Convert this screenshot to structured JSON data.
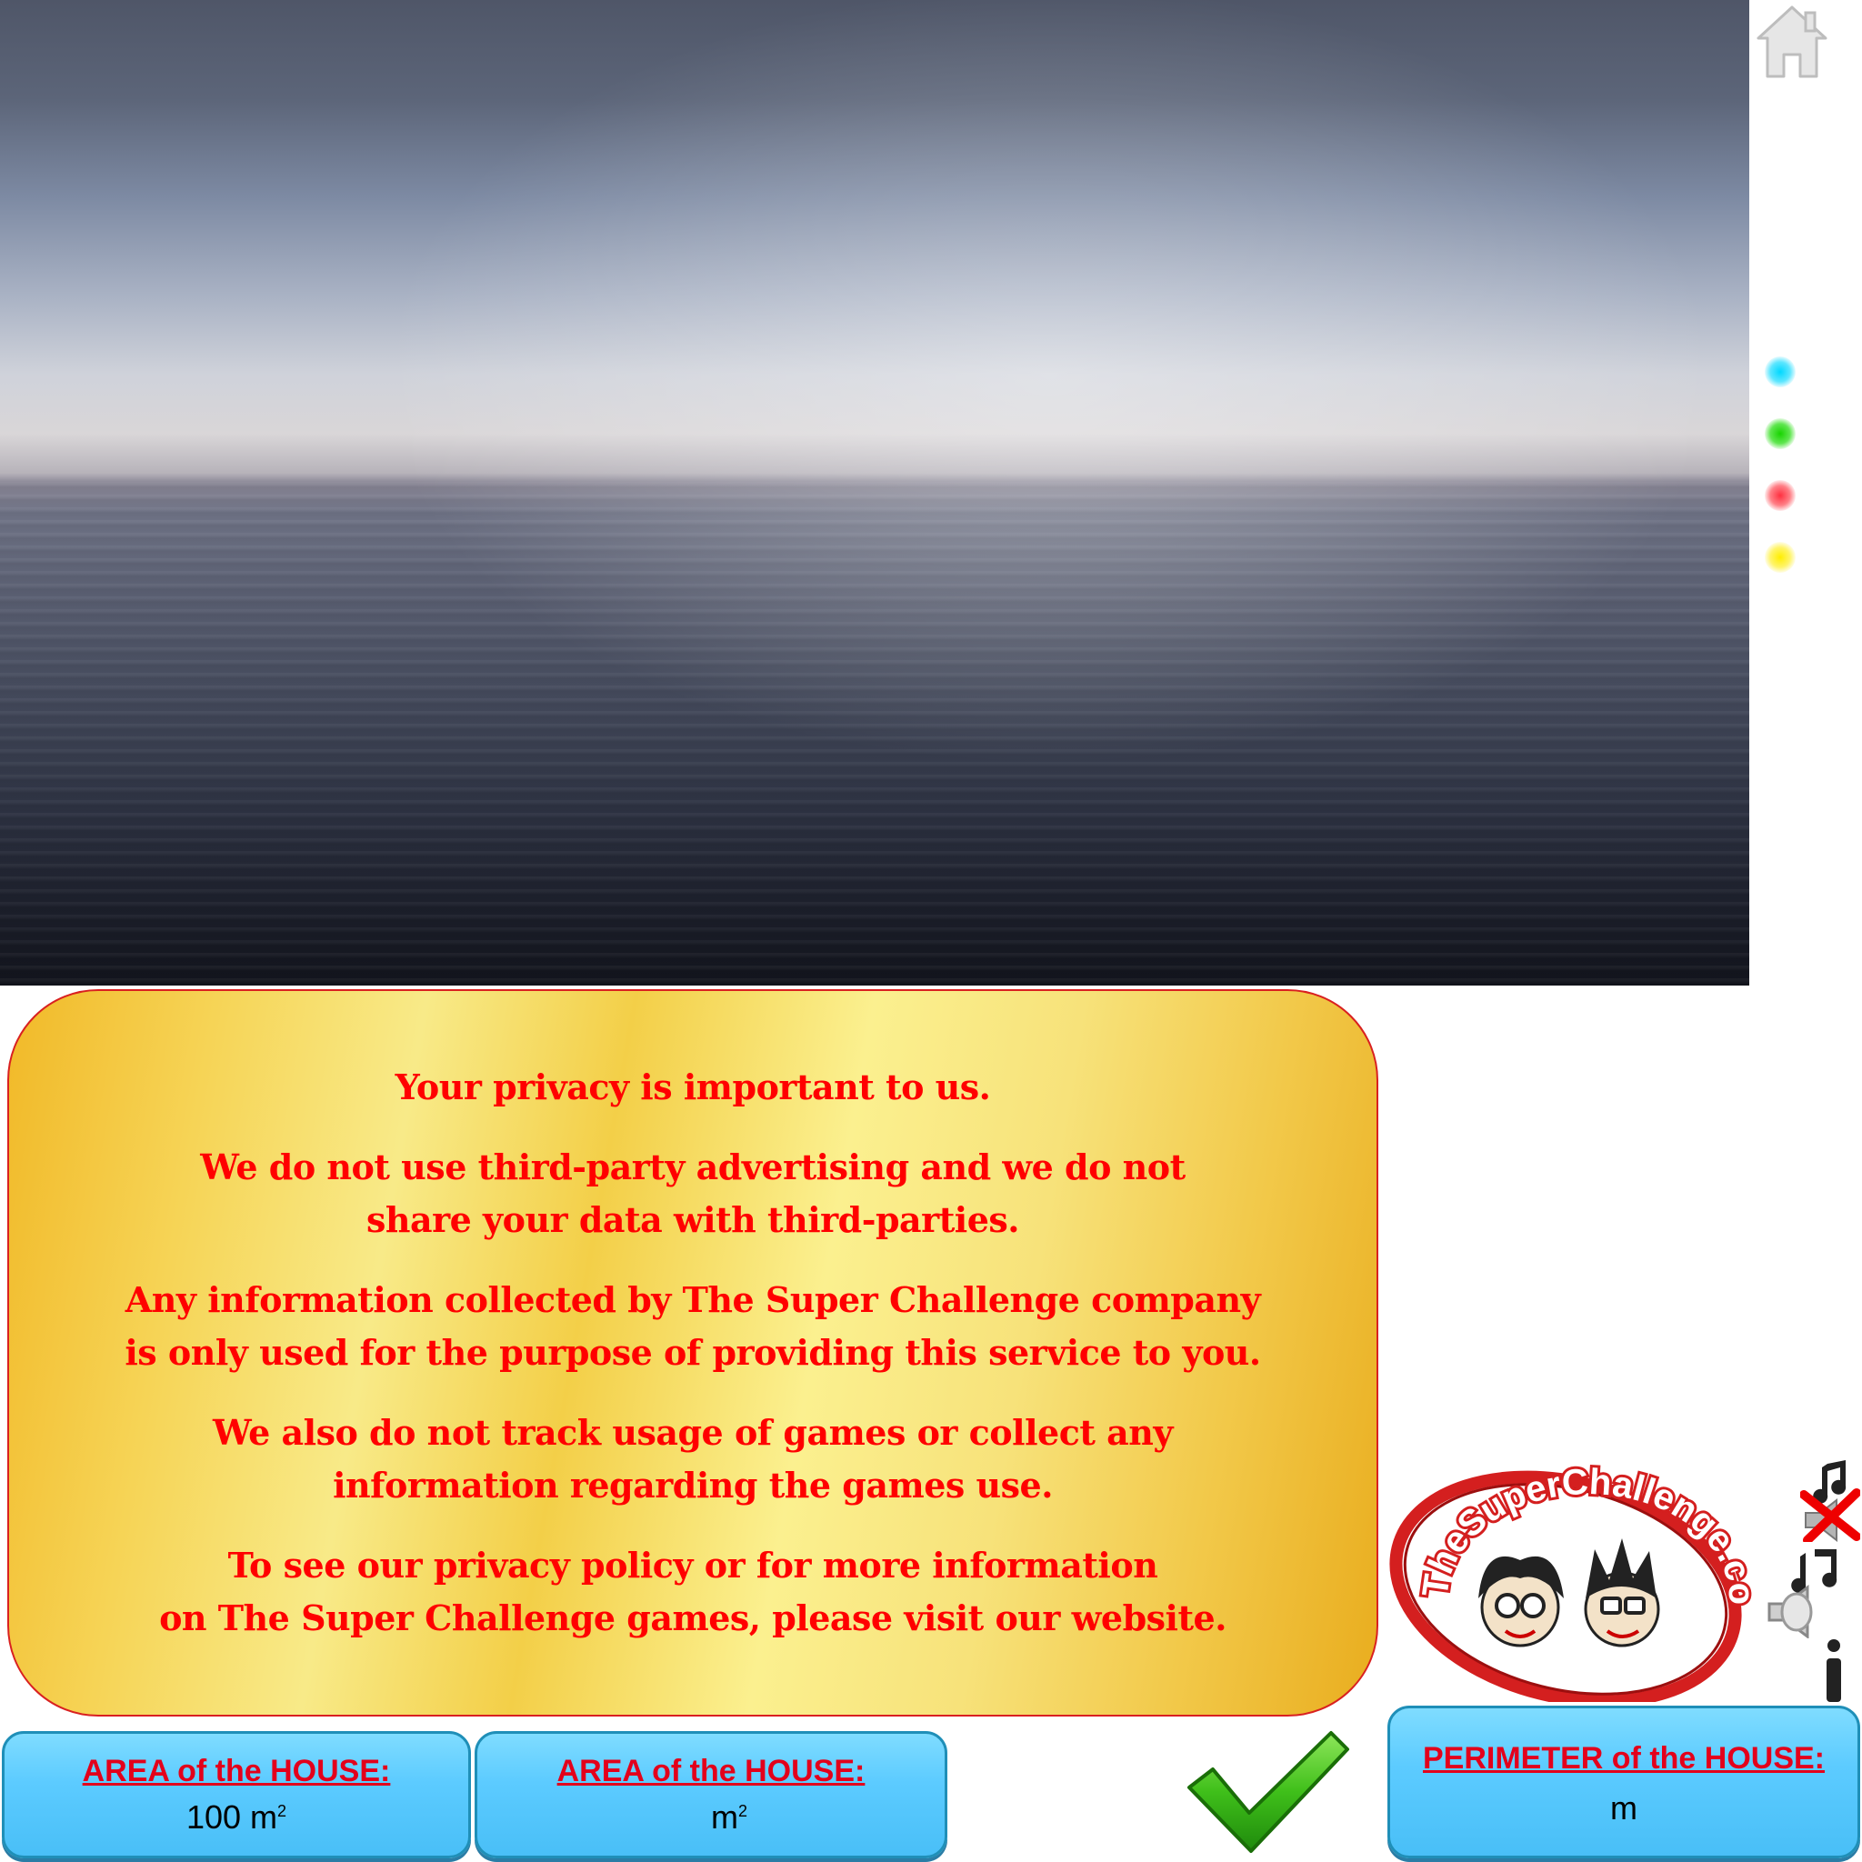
{
  "nav": {
    "home_icon": "home-icon",
    "color_dots": [
      {
        "name": "cyan",
        "color": "#00d8ff"
      },
      {
        "name": "green",
        "color": "#18d400"
      },
      {
        "name": "red",
        "color": "#ff3040"
      },
      {
        "name": "yellow",
        "color": "#ffee00"
      }
    ]
  },
  "privacy": {
    "line1": "Your privacy is important to us.",
    "line2": "We do not use third-party advertising and we do not\nshare your data with third-parties.",
    "line3": "Any information collected by The Super Challenge company\nis only used for the purpose of providing this service to you.",
    "line4": "We also do not track usage of games or collect any\ninformation regarding the games use.",
    "line5": "To see our privacy policy or for more information\non The Super Challenge games, please visit our website."
  },
  "area_given": {
    "title": "AREA of the HOUSE:",
    "value": "100 m",
    "unit_sup": "2"
  },
  "area_answer": {
    "title": "AREA of the HOUSE:",
    "value": "m",
    "unit_sup": "2"
  },
  "perimeter": {
    "title": "PERIMETER of the HOUSE:",
    "value": "m"
  },
  "logo": {
    "text": "TheSuperChallenge.com"
  },
  "controls": {
    "check_icon": "checkmark-icon",
    "mute_icon": "music-mute-icon",
    "sound_icon": "speaker-music-icon",
    "info_icon": "info-icon"
  },
  "colors": {
    "panel_text": "#ff0000",
    "box_title": "#e3001b",
    "box_bg": "#5ccbff",
    "check_green": "#3fbf1a"
  }
}
